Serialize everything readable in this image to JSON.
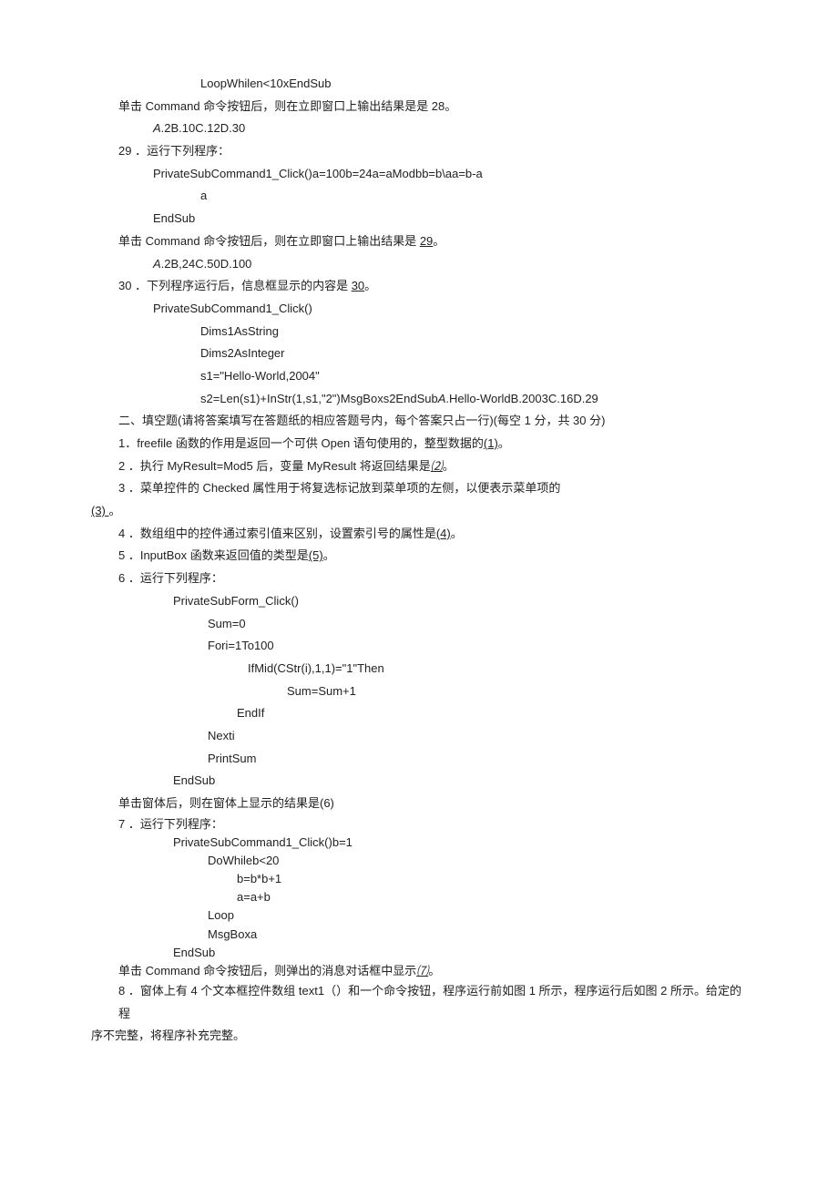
{
  "lines": {
    "l1": "LoopWhilen<10xEndSub",
    "l2a": "单击 Command 命令按钮后，则在立即窗口上输出结果是是 28。",
    "l2b": "A",
    "l2c": ".2B.10C.12D.30",
    "l3": "29 ．运行下列程序：",
    "l4": "PrivateSubCommand1_Click()a=100b=24a=aModbb=b\\aa=b-a",
    "l5": "a",
    "l6": "EndSub",
    "l7a": "单击 Command 命令按钮后，则在立即窗口上输出结果是 ",
    "l7u": "29",
    "l7b": "。",
    "l8a": "A",
    "l8b": ".2B,24C.50D.100",
    "l9a": "30 ．下列程序运行后，信息框显示的内容是 ",
    "l9u": "30",
    "l9b": "。",
    "l10": "PrivateSubCommand1_Click()",
    "l11": "Dims1AsString",
    "l12": "Dims2AsInteger",
    "l13": "s1=\"Hello-World,2004\"",
    "l14a": "s2=Len(s1)+InStr(1,s1,\"2\")MsgBoxs2EndSub",
    "l14b": "A",
    "l14c": ".Hello-WorldB.2003C.16D.29",
    "l15": "二、填空题(请将答案填写在答题纸的相应答题号内，每个答案只占一行)(每空 1 分，共 30 分)",
    "l16a": "1．freefile 函数的作用是返回一个可供 Open 语句使用的，整型数据的",
    "l16u": "(1)",
    "l16b": "。",
    "l17a": "2 ．执行 MyResult=Mod5 后，变量 MyResult 将返回结果是",
    "l17u": "⑵",
    "l17b": "。",
    "l18": "3 ．菜单控件的 Checked 属性用于将复选标记放到菜单项的左侧，以便表示菜单项的",
    "l19a": "(3)  ",
    "l19b": "。",
    "l20a": "4 ．数组组中的控件通过索引值来区别，设置索引号的属性是",
    "l20u": "(4)",
    "l20b": "。",
    "l21a": "5 ．InputBox 函数来返回值的类型是",
    "l21u": "(5)",
    "l21b": "。",
    "l22": "6 ．运行下列程序：",
    "l23": "PrivateSubForm_Click()",
    "l24": "Sum=0",
    "l25": "Fori=1To100",
    "l26": "IfMid(CStr(i),1,1)=\"1\"Then",
    "l27": "Sum=Sum+1",
    "l28": "EndIf",
    "l29": "Nexti",
    "l30": "PrintSum",
    "l31": "EndSub",
    "l32": "单击窗体后，则在窗体上显示的结果是(6)",
    "l33": "7 ．运行下列程序：",
    "l34": "PrivateSubCommand1_Click()b=1",
    "l35": "DoWhileb<20",
    "l36": "b=b*b+1",
    "l37": "a=a+b",
    "l38": "Loop",
    "l38a": "MsgBoxa",
    "l39": "EndSub",
    "l40a": "单击 Command 命令按钮后，则弹出的消息对话框中显示",
    "l40u": "⑺",
    "l40b": "。",
    "l41": "8 ．窗体上有 4 个文本框控件数组 text1（）和一个命令按钮，程序运行前如图 1 所示，程序运行后如图 2 所示。给定的程",
    "l42": "序不完整，将程序补充完整。"
  }
}
